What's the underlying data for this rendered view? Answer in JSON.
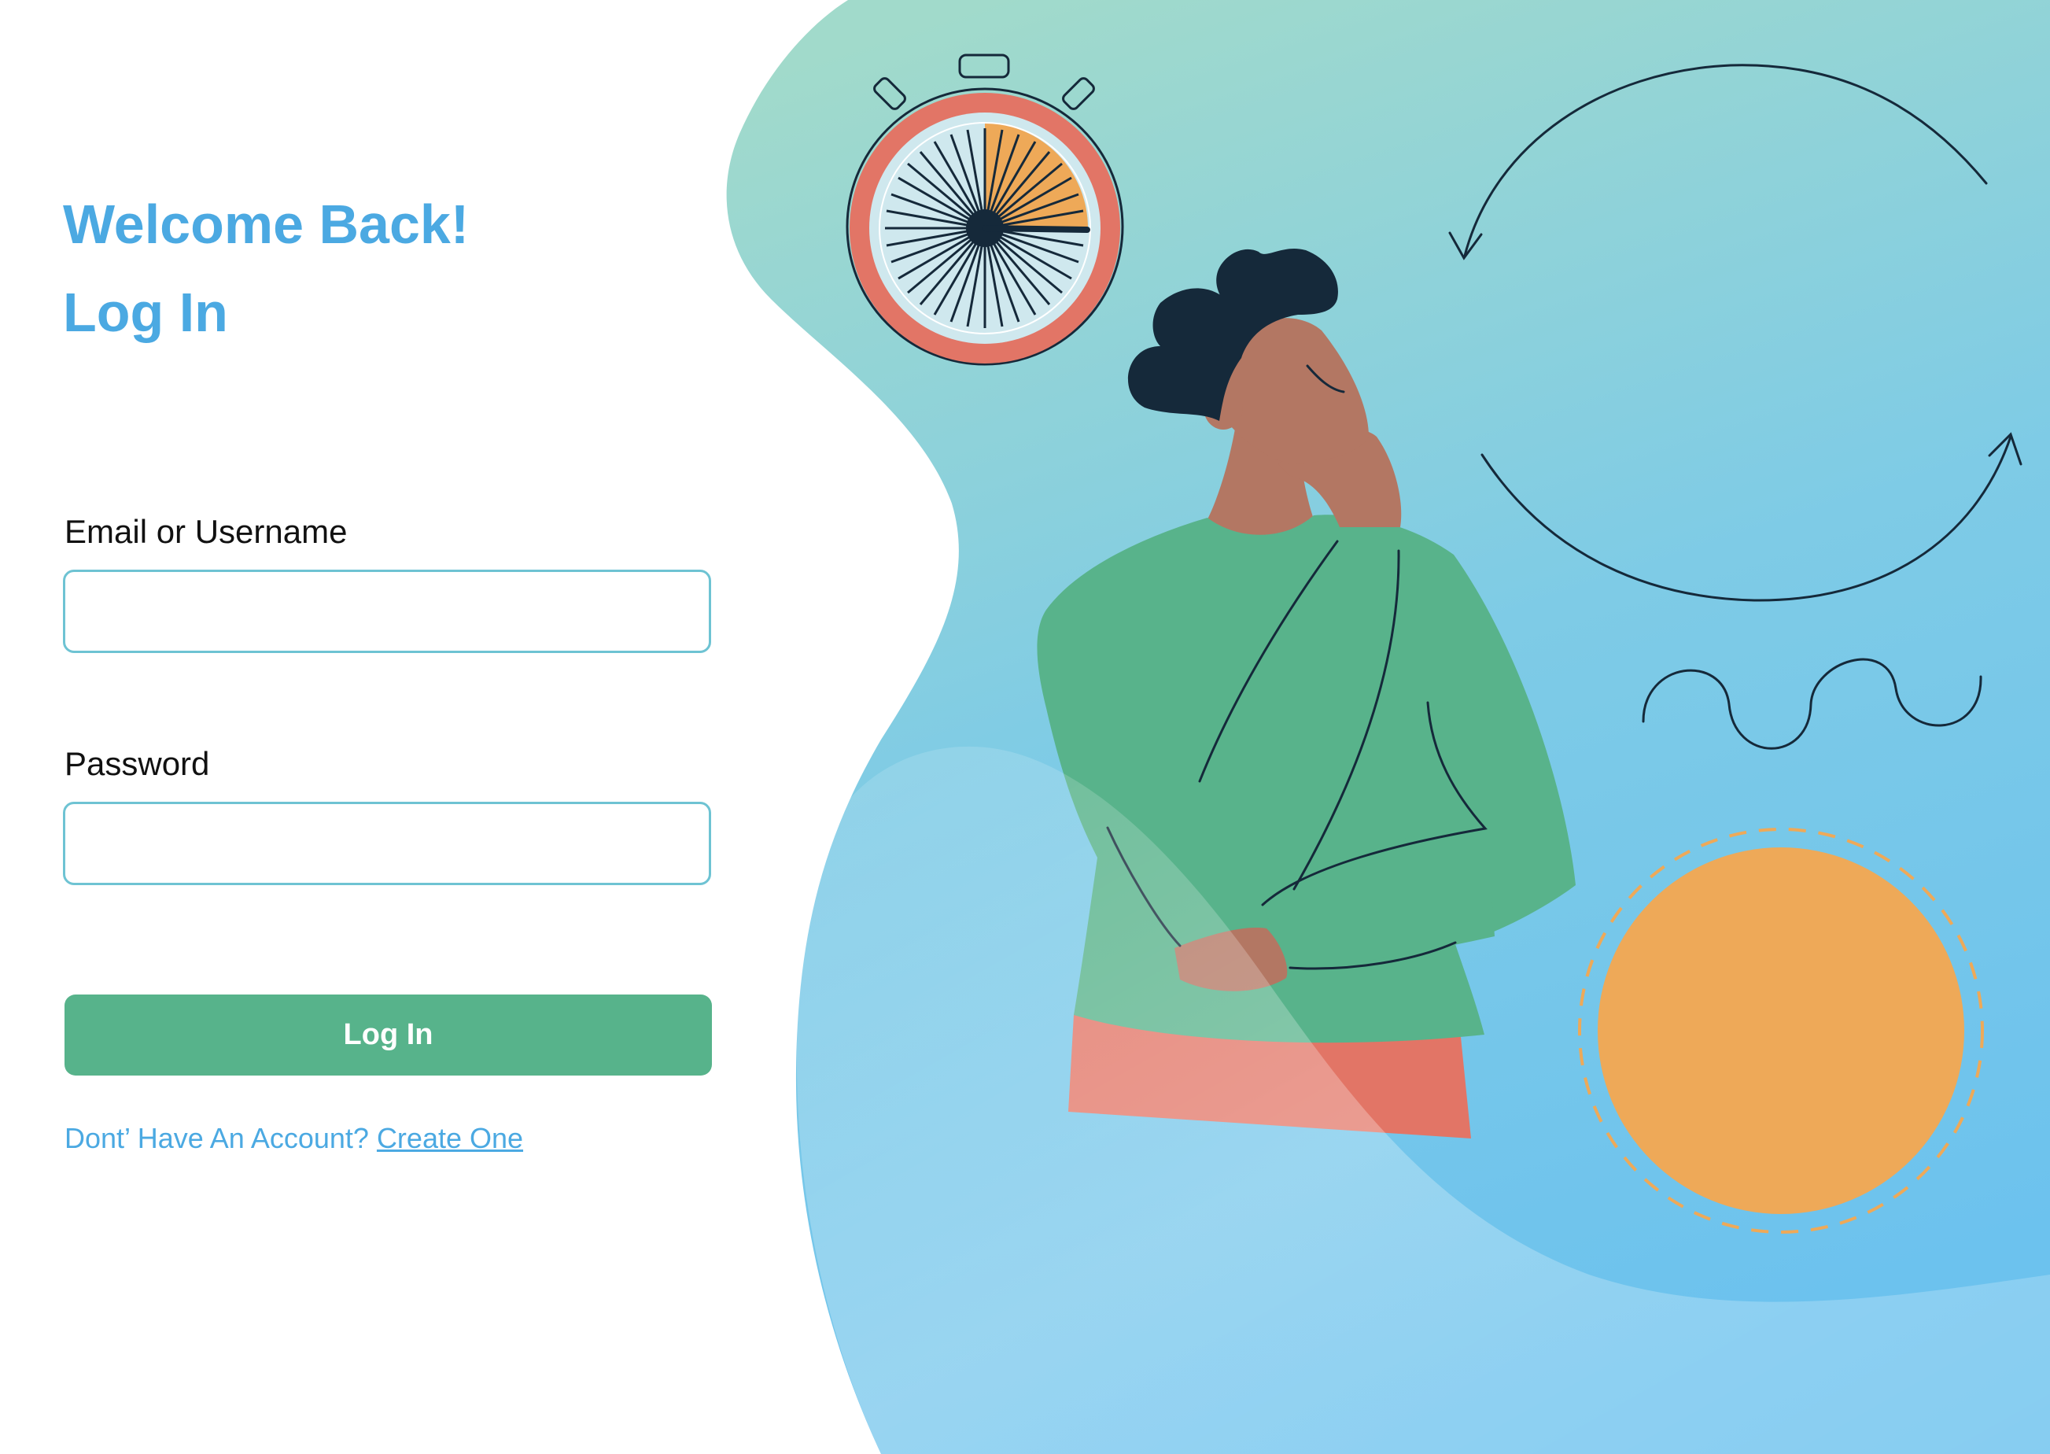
{
  "login": {
    "title": "Welcome Back!",
    "subtitle": "Log In",
    "email_label": "Email or Username",
    "email_value": "",
    "password_label": "Password",
    "password_value": "",
    "submit_label": "Log In",
    "signup_prompt": "Dont’ Have An Account?",
    "signup_link": "Create One"
  },
  "colors": {
    "accent_blue": "#4BA9E2",
    "field_border": "#6EC3D3",
    "button_green": "#57B38B",
    "sun_orange": "#EEA958",
    "timer_red": "#E27566",
    "background_blue": "#72C6EE",
    "background_teal": "#A1DACB"
  },
  "illustration": {
    "icons": [
      "stopwatch-icon",
      "cycle-arrows-icon",
      "wave-squiggle-icon",
      "sun-circle-icon"
    ],
    "figure": "thinking-person"
  }
}
